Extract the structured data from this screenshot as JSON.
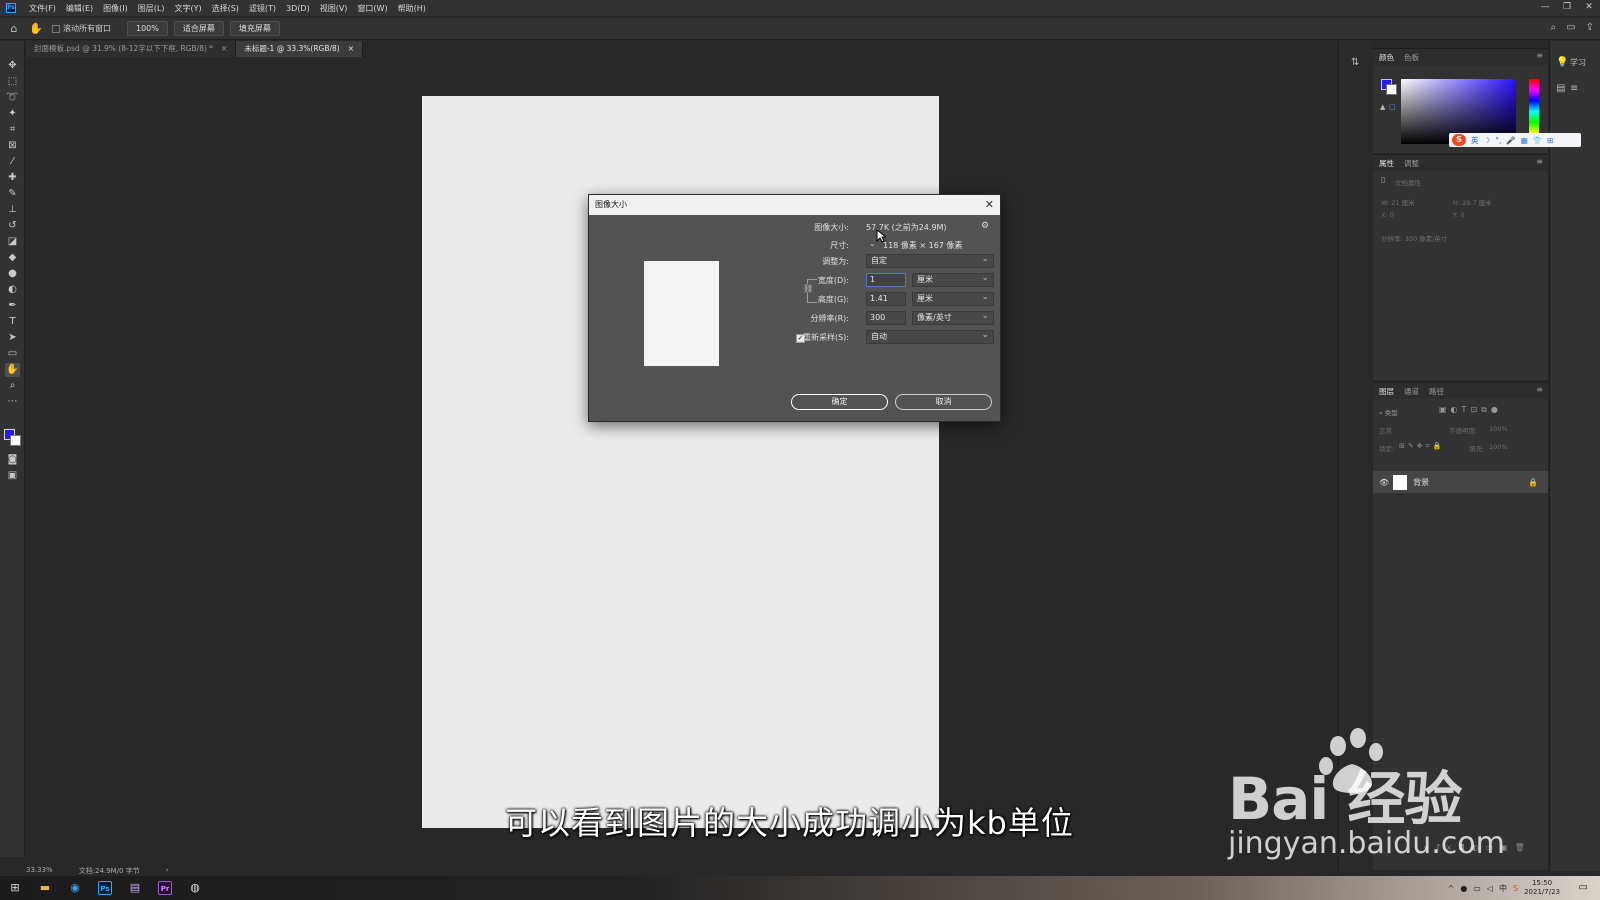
{
  "menubar": {
    "logo": "Ps",
    "items": [
      "文件(F)",
      "编辑(E)",
      "图像(I)",
      "图层(L)",
      "文字(Y)",
      "选择(S)",
      "滤镜(T)",
      "3D(D)",
      "视图(V)",
      "窗口(W)",
      "帮助(H)"
    ],
    "window_controls": [
      "—",
      "❐",
      "✕"
    ]
  },
  "optbar": {
    "scroll_all_label": "滚动所有窗口",
    "zoom_100": "100%",
    "fit_screen": "适合屏幕",
    "fill_screen": "填充屏幕"
  },
  "tabs": [
    {
      "label": "封面模板.psd @ 31.9% (8-12字以下下框, RGB/8) *",
      "close": "×"
    },
    {
      "label": "未标题-1 @ 33.3%(RGB/8)",
      "close": "×"
    }
  ],
  "statusbar": {
    "zoom": "33.33%",
    "doc_info": "文档:24.9M/0 字节",
    "arrow": "›"
  },
  "color_panel": {
    "tabs": [
      "颜色",
      "色板"
    ]
  },
  "ime": {
    "logo": "S",
    "label": "英",
    "icons": [
      "☽",
      "°,",
      "🎤",
      "▦",
      "👕",
      "⊞"
    ]
  },
  "properties_panel": {
    "tabs": [
      "属性",
      "调整"
    ],
    "section": "文档属性",
    "w": "W: 21 厘米",
    "h": "H: 29.7 厘米",
    "x": "X: 0",
    "y": "Y: 0",
    "resolution": "分辨率: 300 像素/英寸"
  },
  "layers_panel": {
    "tabs": [
      "图层",
      "通道",
      "路径"
    ],
    "search_placeholder": "类型",
    "blend_mode": "正常",
    "opacity_label": "不透明度:",
    "opacity_value": "100%",
    "lock_label": "锁定:",
    "fill_label": "填充:",
    "fill_value": "100%",
    "layer_name": "背景"
  },
  "right_strip": {
    "learn": "学习"
  },
  "dialog": {
    "title": "图像大小",
    "image_size_label": "图像大小:",
    "image_size_value": "57.7K (之前为24.9M)",
    "dimensions_label": "尺寸:",
    "dimensions_value": "118 像素 × 167 像素",
    "fit_label": "调整为:",
    "fit_value": "自定",
    "width_label": "宽度(D):",
    "width_value": "1",
    "width_unit": "厘米",
    "height_label": "高度(G):",
    "height_value": "1.41",
    "height_unit": "厘米",
    "resolution_label": "分辨率(R):",
    "resolution_value": "300",
    "resolution_unit": "像素/英寸",
    "resample_label": "重新采样(S):",
    "resample_value": "自动",
    "ok": "确定",
    "cancel": "取消"
  },
  "subtitle": "可以看到图片的大小成功调小为kb单位",
  "watermark": {
    "brand": "Bai  经验",
    "url": "jingyan.baidu.com"
  },
  "taskbar": {
    "apps": [
      "Ps",
      "Pr"
    ],
    "time": "15:50",
    "date": "2021/7/23"
  }
}
